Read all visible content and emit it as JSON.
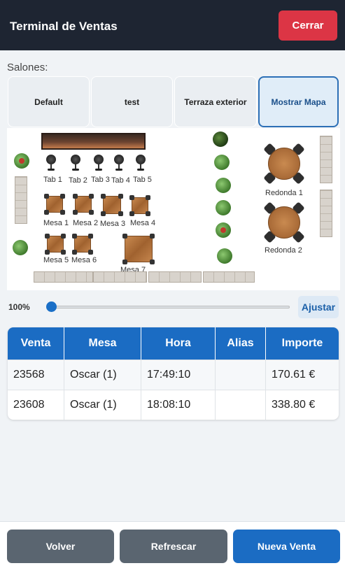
{
  "header": {
    "title": "Terminal de Ventas",
    "close_label": "Cerrar"
  },
  "salones": {
    "label": "Salones:",
    "tabs": [
      {
        "label": "Default"
      },
      {
        "label": "test"
      },
      {
        "label": "Terraza exterior"
      },
      {
        "label": "Mostrar Mapa",
        "active": true
      }
    ]
  },
  "map": {
    "stools": [
      "Tab 1",
      "Tab 2",
      "Tab 3",
      "Tab 4",
      "Tab 5"
    ],
    "tables": [
      "Mesa 1",
      "Mesa 2",
      "Mesa 3",
      "Mesa 4",
      "Mesa 5",
      "Mesa 6",
      "Mesa 7"
    ],
    "round_tables": [
      "Redonda 1",
      "Redonda 2"
    ]
  },
  "zoom": {
    "label": "100%",
    "fit_label": "Ajustar",
    "level": 0
  },
  "sales": {
    "headers": [
      "Venta",
      "Mesa",
      "Hora",
      "Alias",
      "Importe"
    ],
    "rows": [
      {
        "venta": "23568",
        "mesa": "Oscar (1)",
        "hora": "17:49:10",
        "alias": "",
        "importe": "170.61 €"
      },
      {
        "venta": "23608",
        "mesa": "Oscar (1)",
        "hora": "18:08:10",
        "alias": "",
        "importe": "338.80 €"
      }
    ]
  },
  "footer": {
    "back_label": "Volver",
    "refresh_label": "Refrescar",
    "new_sale_label": "Nueva Venta"
  },
  "colors": {
    "header_bg": "#1e2532",
    "danger": "#dc3545",
    "primary": "#1b6cc3",
    "secondary": "#5a6570"
  }
}
